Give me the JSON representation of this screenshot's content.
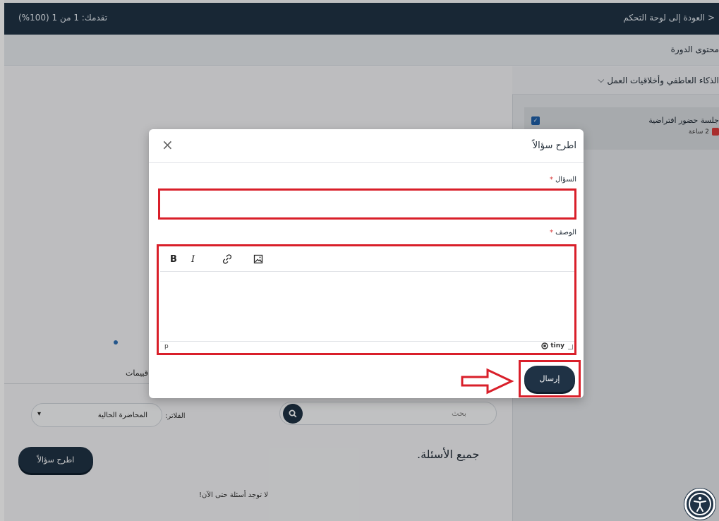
{
  "topbar": {
    "back_label": "< العودة إلى لوحة التحكم",
    "progress": "تقدمك: 1 من 1 (100%)"
  },
  "course": {
    "content_title": "محتوى الدورة",
    "section_title": "الذكاء العاطفي وأخلاقيات العمل",
    "session_name": "جلسة حضور افتراضية",
    "session_duration": "2 ساعة"
  },
  "main": {
    "tab_partial": "قييمات",
    "search_placeholder": "بحث",
    "filter_label": "الفلاتر:",
    "filter_value": "المحاضرة الحالية",
    "all_questions": "جميع الأسئلة.",
    "ask_button": "اطرح سؤالاً",
    "no_questions": "لا توجد أسئلة حتى الآن!"
  },
  "modal": {
    "title": "اطرح سؤالاً",
    "question_label": "السؤال",
    "description_label": "الوصف",
    "required_mark": "*",
    "editor_status_path": "p",
    "editor_brand": "tiny",
    "send_button": "إرسال",
    "close_icon": "close-icon"
  },
  "colors": {
    "navy": "#1f3245",
    "annotation_red": "#d91f2a"
  }
}
